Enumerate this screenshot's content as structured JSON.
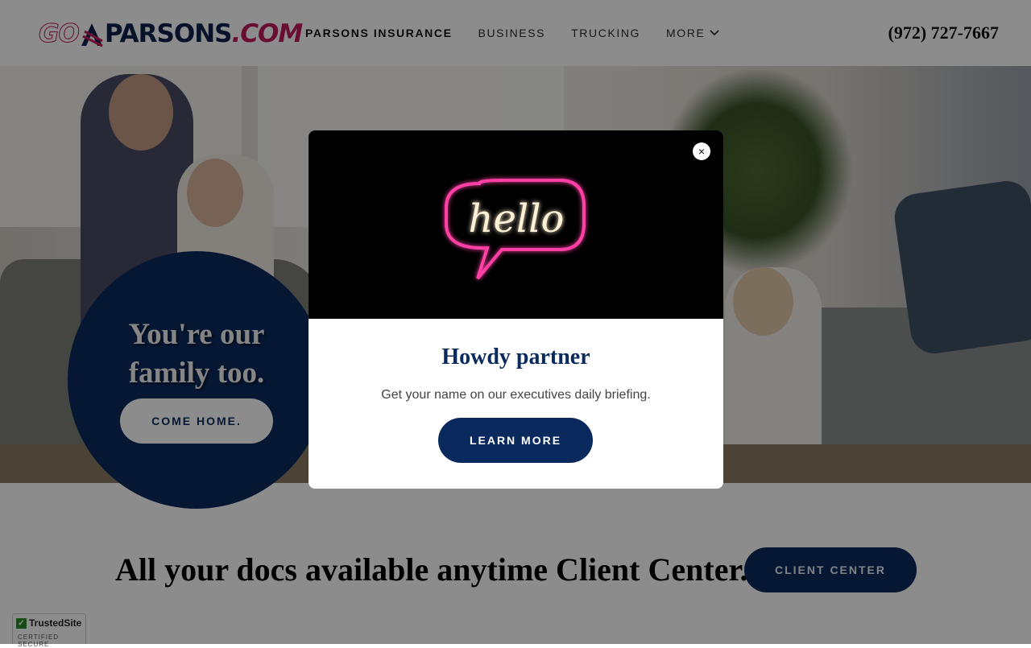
{
  "header": {
    "logo_go": "GO",
    "logo_parsons": "PARSONS",
    "logo_dotcom": ".COM",
    "nav": [
      {
        "label": "PARSONS INSURANCE"
      },
      {
        "label": "BUSINESS"
      },
      {
        "label": "TRUCKING"
      },
      {
        "label": "MORE"
      }
    ],
    "phone": "(972) 727-7667"
  },
  "hero": {
    "title_line1": "You're our",
    "title_line2": "family too.",
    "cta_label": "COME HOME."
  },
  "docs": {
    "title": "All your docs available anytime Client Center.",
    "button_label": "CLIENT CENTER"
  },
  "badge": {
    "name": "TrustedSite",
    "tagline": "CERTIFIED SECURE"
  },
  "modal": {
    "image_text": "hello",
    "close_label": "×",
    "title": "Howdy partner",
    "text": "Get your name on our executives daily briefing.",
    "button_label": "LEARN MORE"
  },
  "colors": {
    "brand_navy": "#0a2a5e",
    "brand_pink": "#c2185b",
    "neon_pink": "#ff3fa4",
    "neon_warm": "#fff1d6"
  }
}
